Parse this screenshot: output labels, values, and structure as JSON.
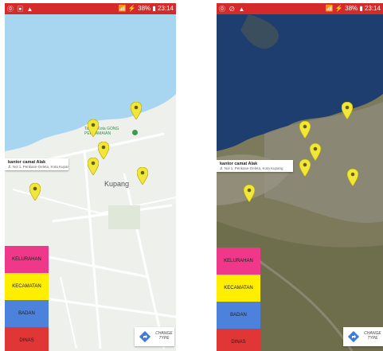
{
  "left_screen": {
    "status_bar": {
      "right_text": "📶 ⚡ 38% ▮ 23:14",
      "left_icons": "⓪ ▣ ▲"
    },
    "info_window": {
      "title": "kantor camat Alak",
      "subtitle": "Jl. Nol 1, Penkase-Oeleta, Kota Kupang"
    },
    "map_labels": {
      "city": "Kupang",
      "poi": "Taman Kota GONG PERDAMAIAN"
    },
    "buttons": [
      "KELURAHAN",
      "KECAMATAN",
      "BADAN",
      "DINAS"
    ],
    "change_type": "CHANGE TYPE"
  },
  "right_screen": {
    "status_bar": {
      "right_text": "📶 ⚡ 38% ▮ 23:14",
      "left_icons": "⓪ ⊘ ▲"
    },
    "info_window": {
      "title": "kantor camat Alak",
      "subtitle": "Jl. Nol 1, Penkase-Oeleta, Kota Kupang"
    },
    "buttons": [
      "KELURAHAN",
      "KECAMATAN",
      "BADAN",
      "DINAS"
    ],
    "change_type": "CHANGE TYPE"
  },
  "colors": {
    "status_bar": "#d42a2a",
    "kelurahan": "#f0388a",
    "kecamatan": "#ffee00",
    "badan": "#4c82dc",
    "dinas": "#e13636",
    "pin": "#f0e63c",
    "sea_left": "#a8d6f0",
    "land_left": "#eef0ec",
    "sea_right": "#1e3e70",
    "land_right": "#7c7a5a"
  }
}
